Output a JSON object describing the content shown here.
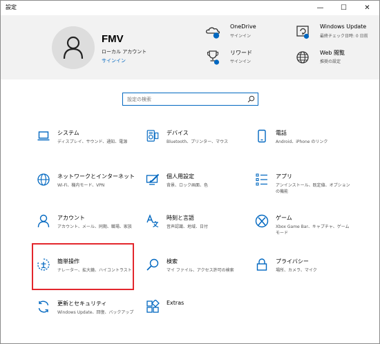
{
  "window": {
    "title": "設定",
    "minimize": "—",
    "maximize": "☐",
    "close": "✕"
  },
  "account": {
    "name": "FMV",
    "type": "ローカル アカウント",
    "signin": "サインイン"
  },
  "header_items": [
    {
      "title": "OneDrive",
      "sub": "サインイン"
    },
    {
      "title": "Windows Update",
      "sub": "最終チェック日時: 0 日前"
    },
    {
      "title": "リワード",
      "sub": "サインイン"
    },
    {
      "title": "Web 閲覧",
      "sub": "推奨の設定"
    }
  ],
  "search": {
    "placeholder": "設定の検索"
  },
  "categories": [
    {
      "title": "システム",
      "desc": "ディスプレイ、サウンド、通知、電源"
    },
    {
      "title": "デバイス",
      "desc": "Bluetooth、プリンター、マウス"
    },
    {
      "title": "電話",
      "desc": "Android、iPhone のリンク"
    },
    {
      "title": "ネットワークとインターネット",
      "desc": "Wi-Fi、機内モード、VPN"
    },
    {
      "title": "個人用設定",
      "desc": "背景、ロック画面、色"
    },
    {
      "title": "アプリ",
      "desc": "アンインストール、既定値、オプションの機能"
    },
    {
      "title": "アカウント",
      "desc": "アカウント、メール、同期、職場、家族"
    },
    {
      "title": "時刻と言語",
      "desc": "音声認識、地域、日付"
    },
    {
      "title": "ゲーム",
      "desc": "Xbox Game Bar、キャプチャ、ゲーム モード"
    },
    {
      "title": "簡単操作",
      "desc": "ナレーター、拡大鏡、ハイコントラスト"
    },
    {
      "title": "検索",
      "desc": "マイ ファイル、アクセス許可の検索"
    },
    {
      "title": "プライバシー",
      "desc": "場所、カメラ、マイク"
    },
    {
      "title": "更新とセキュリティ",
      "desc": "Windows Update、回復、バックアップ"
    },
    {
      "title": "Extras",
      "desc": ""
    }
  ],
  "colors": {
    "accent": "#0067c0",
    "highlight": "#e3262c",
    "header_bg": "#f2f2f2"
  }
}
